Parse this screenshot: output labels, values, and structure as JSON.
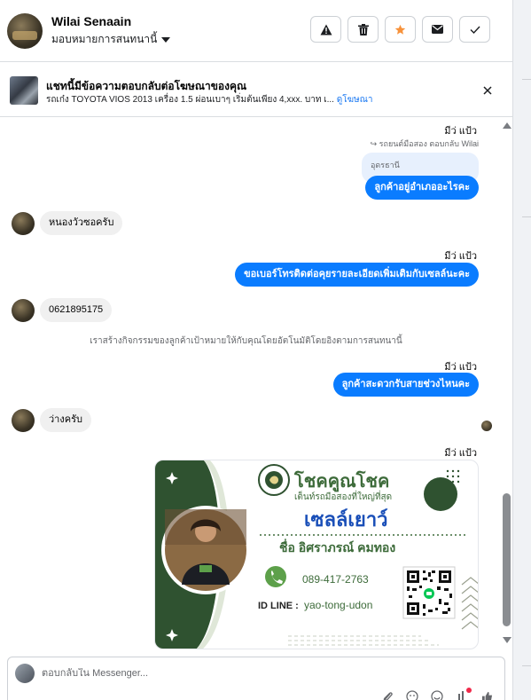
{
  "header": {
    "contact_name": "Wilai Senaain",
    "assign_label": "มอบหมายการสนทนานี้",
    "buttons": [
      {
        "name": "report-button",
        "icon": "warning-icon"
      },
      {
        "name": "delete-button",
        "icon": "trash-icon"
      },
      {
        "name": "star-button",
        "icon": "star-icon"
      },
      {
        "name": "mark-unread-button",
        "icon": "envelope-icon"
      },
      {
        "name": "mark-done-button",
        "icon": "check-icon"
      }
    ]
  },
  "ad": {
    "title": "แชทนี้มีข้อความตอบกลับต่อโฆษณาของคุณ",
    "subtitle": "รถเก๋ง TOYOTA VIOS 2013 เครื่อง 1.5 ผ่อนเบาๆ เริ่มต้นเพียง 4,xxx. บาท เ...",
    "link": "ดูโฆษณา"
  },
  "messages": {
    "read_1": "มีว่ แป้ว",
    "reply_note": "รถยนต์มือสอง ตอบกลับ Wilai",
    "quoted_text": "อุดรธานี",
    "out_1": "ลูกค้าอยู่อำเภออะไรคะ",
    "in_1": "หนองวัวซอครับ",
    "read_2": "มีว่ แป้ว",
    "out_2": "ขอเบอร์โทรติดต่อคุยรายละเอียดเพิ่มเติมกับเซลล์นะคะ",
    "in_2": "0621895175",
    "system_note": "เราสร้างกิจกรรมของลูกค้าเป้าหมายให้กับคุณโดยอัตโนมัติโดยอิงตามการสนทนานี้",
    "read_3": "มีว่ แป้ว",
    "out_3": "ลูกค้าสะดวกรับสายช่วงไหนคะ",
    "in_3": "ว่างครับ",
    "read_4": "มีว่ แป้ว"
  },
  "business_card": {
    "brand": "โชคคูณโชค",
    "tagline": "เต็นท์รถมือสองที่ใหญ่ที่สุด",
    "role": "เซลล์เยาว์",
    "full_name": "ชื่อ อิศราภรณ์  คมทอง",
    "phone": "089-417-2763",
    "line_label": "ID LINE :",
    "line_id": "yao-tong-udon",
    "colors": {
      "green": "#2f5230",
      "text_green": "#3d6b3a",
      "blue": "#1a4fb8"
    }
  },
  "composer": {
    "placeholder": "ตอบกลับใน Messenger...",
    "tools": [
      "attach-icon",
      "gif-icon",
      "emoji-icon",
      "like-icon",
      "thumbs-up-icon"
    ]
  }
}
